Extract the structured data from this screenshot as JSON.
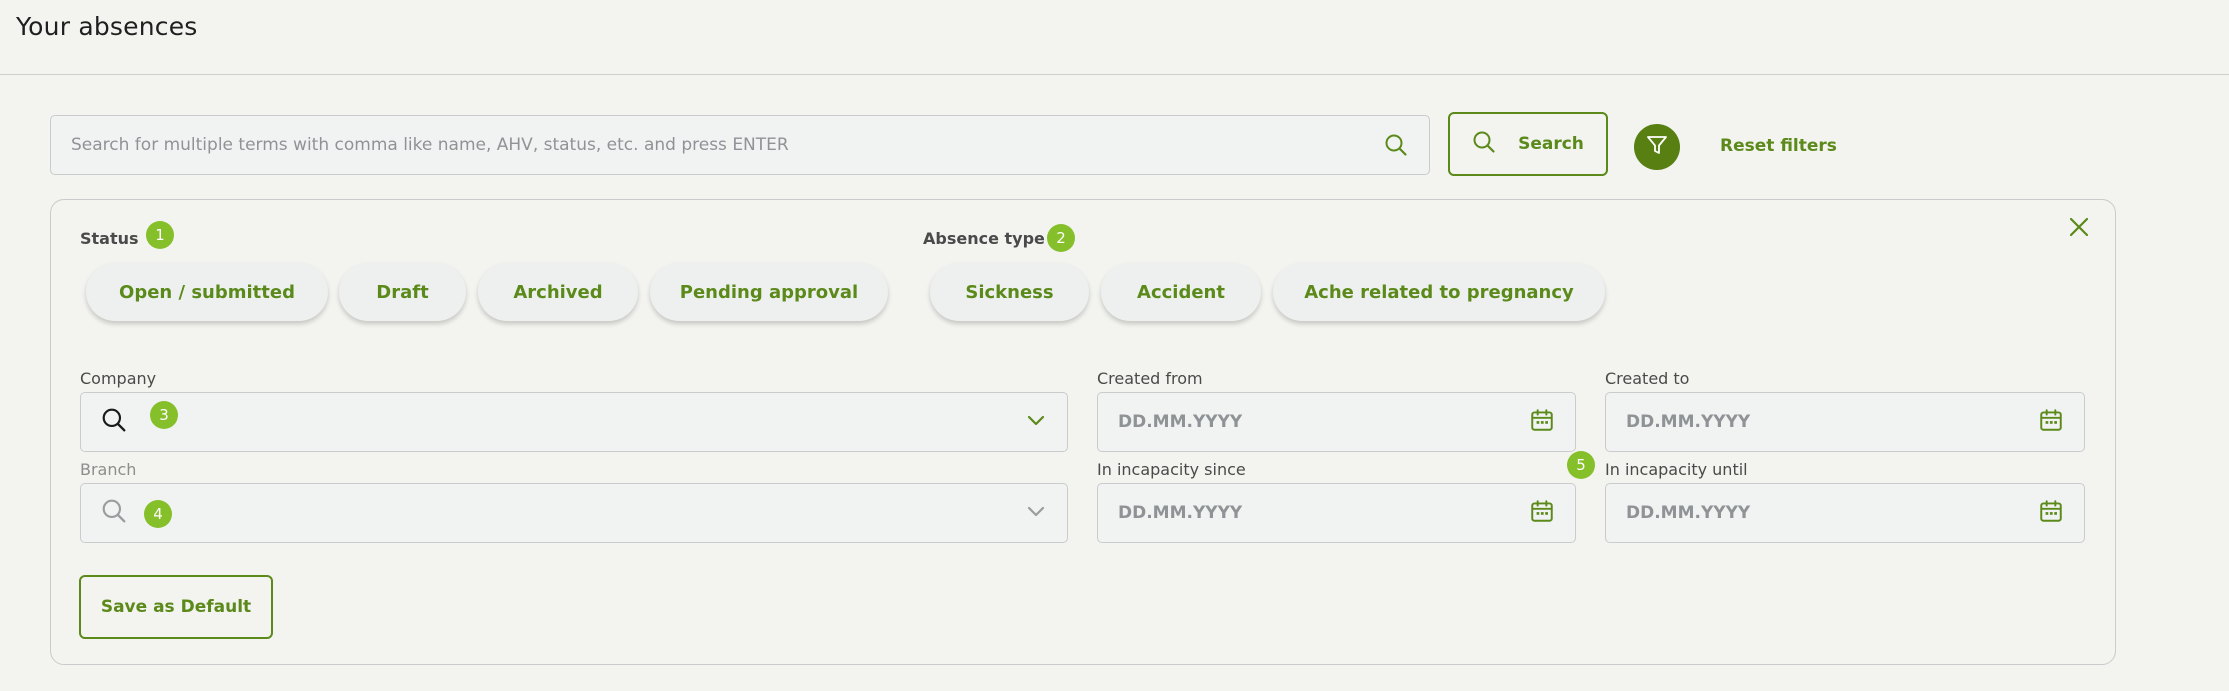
{
  "page": {
    "title": "Your absences"
  },
  "search": {
    "placeholder": "Search for multiple terms with comma like name, AHV, status, etc. and press ENTER",
    "button_label": "Search"
  },
  "filters": {
    "reset_label": "Reset filters",
    "status": {
      "label": "Status",
      "badge": "1",
      "chips": [
        "Open / submitted",
        "Draft",
        "Archived",
        "Pending approval"
      ]
    },
    "absence_type": {
      "label": "Absence type",
      "badge": "2",
      "chips": [
        "Sickness",
        "Accident",
        "Ache related to pregnancy"
      ]
    },
    "company": {
      "label": "Company",
      "badge": "3",
      "value": ""
    },
    "branch": {
      "label": "Branch",
      "badge": "4",
      "value": ""
    },
    "created_from": {
      "label": "Created from",
      "placeholder": "DD.MM.YYYY"
    },
    "created_to": {
      "label": "Created to",
      "placeholder": "DD.MM.YYYY"
    },
    "incapacity_since": {
      "label": "In incapacity since",
      "placeholder": "DD.MM.YYYY"
    },
    "incapacity_until": {
      "label": "In incapacity until",
      "badge": "5",
      "placeholder": "DD.MM.YYYY"
    },
    "save_default_label": "Save as Default"
  },
  "colors": {
    "accent": "#5b8a1a",
    "badge": "#85bf2a",
    "filter_button": "#587f12",
    "background": "#f3f3ef"
  },
  "icons": {
    "search": "search-icon",
    "filter": "filter-icon",
    "close": "close-icon",
    "chevron": "chevron-down-icon",
    "calendar": "calendar-icon"
  }
}
